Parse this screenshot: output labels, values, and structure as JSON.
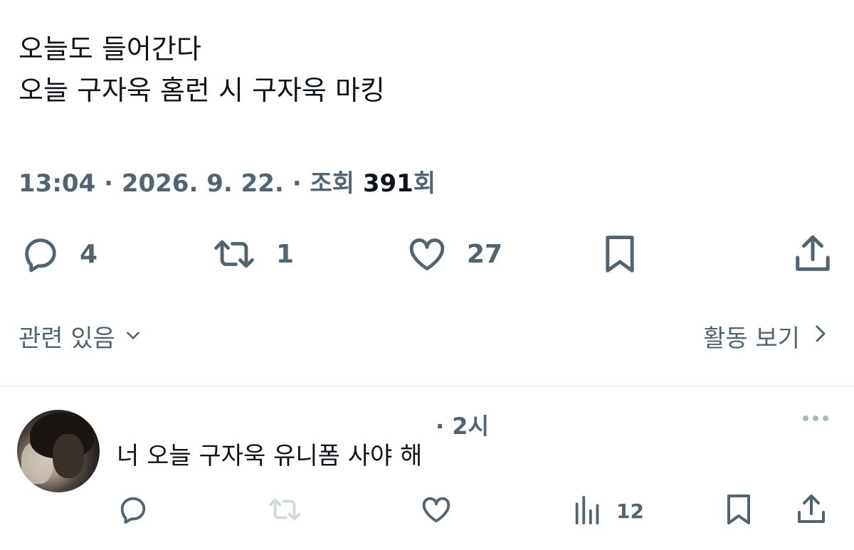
{
  "post": {
    "lines": [
      "오늘도 들어간다",
      "오늘 구자욱 홈런 시 구자욱 마킹"
    ],
    "time": "13:04",
    "separator": " · ",
    "date": "2026. 9. 22.",
    "views_label": "조회",
    "views_count": "391",
    "views_suffix": "회"
  },
  "actions": {
    "reply_count": "4",
    "repost_count": "1",
    "like_count": "27"
  },
  "related": {
    "label": "관련 있음",
    "activity_label": "활동 보기"
  },
  "reply": {
    "time": "· 2시",
    "text": "너 오늘 구자욱 유니폼 사야 해",
    "view_count": "12"
  },
  "colors": {
    "text_primary": "#0f1419",
    "text_secondary": "#536471",
    "divider": "#eff3f4",
    "disabled_icon": "#cfd9de"
  },
  "icons": {
    "reply": "speech-bubble-icon",
    "repost": "repost-arrows-icon",
    "like": "heart-icon",
    "bookmark": "bookmark-icon",
    "share": "share-upload-icon",
    "chevron_down": "chevron-down-icon",
    "chevron_right": "chevron-right-icon",
    "more": "more-dots-icon",
    "views": "bar-chart-icon"
  }
}
